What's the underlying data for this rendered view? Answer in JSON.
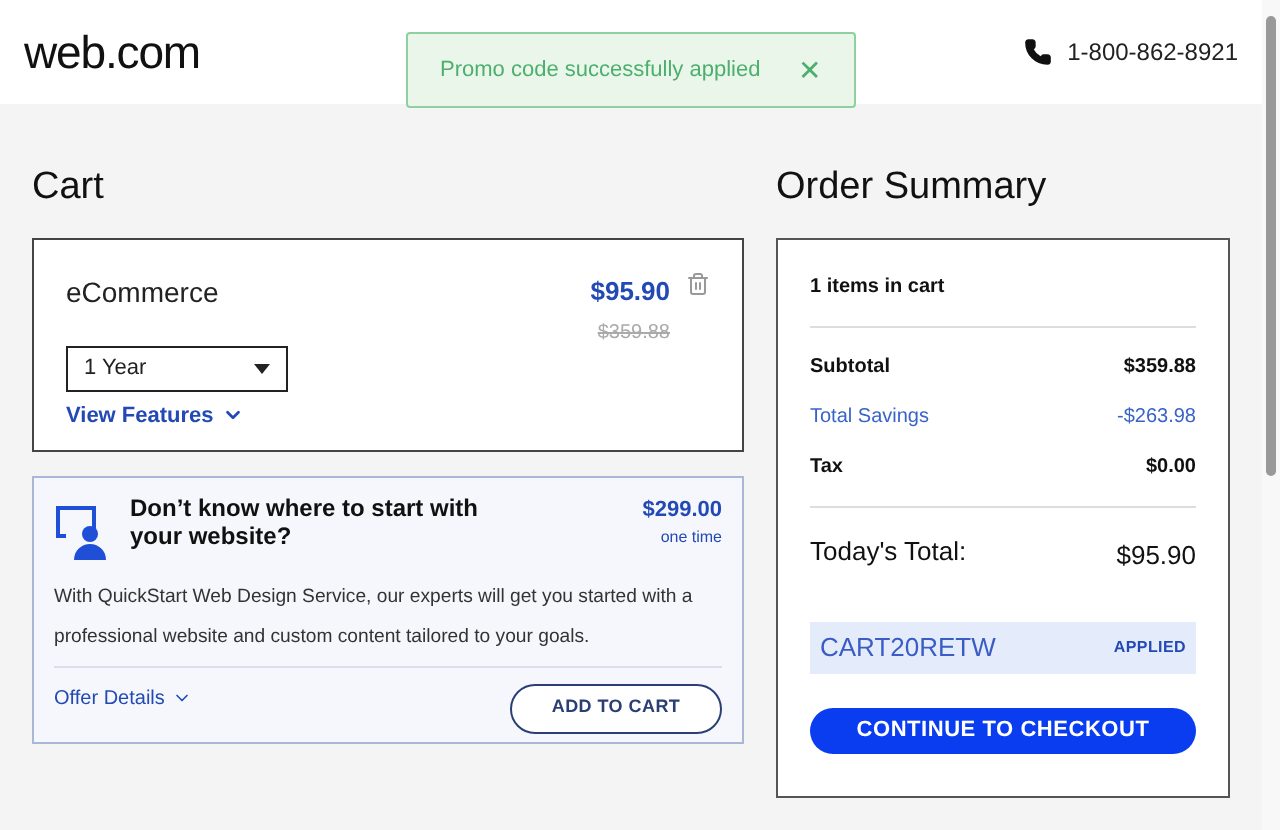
{
  "header": {
    "logo": "web.com",
    "phone": "1-800-862-8921"
  },
  "toast": {
    "message": "Promo code successfully applied",
    "close": "✕"
  },
  "cart": {
    "title": "Cart",
    "item": {
      "name": "eCommerce",
      "price": "$95.90",
      "original_price": "$359.88",
      "term": "1 Year",
      "features_link": "View Features"
    },
    "offer": {
      "title": "Don’t know where to start with your website?",
      "price": "$299.00",
      "price_note": "one time",
      "description": "With QuickStart Web Design Service, our experts will get you started with a professional website and custom content tailored to your goals.",
      "details_link": "Offer Details",
      "button": "ADD TO CART"
    }
  },
  "summary": {
    "title": "Order Summary",
    "count": "1 items in cart",
    "rows": [
      {
        "label": "Subtotal",
        "value": "$359.88",
        "kind": "normal"
      },
      {
        "label": "Total Savings",
        "value": "-$263.98",
        "kind": "savings"
      },
      {
        "label": "Tax",
        "value": "$0.00",
        "kind": "normal"
      }
    ],
    "total_label": "Today's Total:",
    "total": "$95.90",
    "promo": {
      "code": "CART20RETW",
      "status": "APPLIED"
    },
    "checkout": "CONTINUE TO CHECKOUT"
  }
}
